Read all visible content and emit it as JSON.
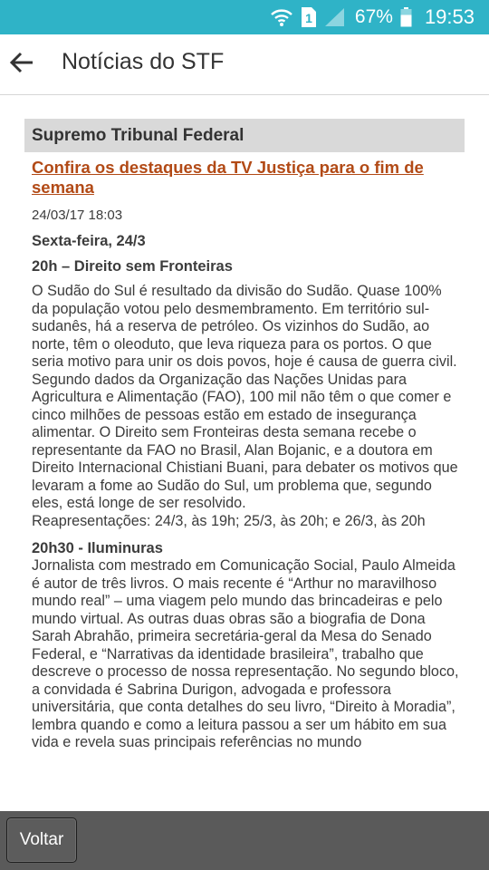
{
  "status_bar": {
    "sim_label": "1",
    "battery_percent": "67%",
    "time": "19:53",
    "icons": [
      "wifi-icon",
      "sim-icon",
      "signal-icon",
      "battery-icon"
    ]
  },
  "app_bar": {
    "title": "Notícias do STF",
    "back_icon": "arrow-left-icon"
  },
  "section": {
    "header": "Supremo Tribunal Federal"
  },
  "article": {
    "title": "Confira os destaques da TV Justiça para o fim de semana",
    "date": "24/03/17 18:03",
    "day_heading": "Sexta-feira, 24/3",
    "program1": {
      "heading": "20h – Direito sem Fronteiras",
      "body": "O Sudão do Sul é resultado da divisão do Sudão. Quase 100% da população votou pelo desmembramento. Em território sul-sudanês, há a reserva de petróleo. Os vizinhos do Sudão, ao norte, têm o oleoduto, que leva riqueza para os portos. O que seria motivo para unir os dois povos, hoje é causa de guerra civil. Segundo dados da Organização das Nações Unidas para Agricultura e Alimentação (FAO), 100 mil não têm o que comer e cinco milhões de pessoas estão em estado de insegurança alimentar. O Direito sem Fronteiras desta semana recebe o representante da FAO no Brasil, Alan Bojanic, e a doutora em Direito Internacional Chistiani Buani, para debater os motivos que levaram a fome ao Sudão do Sul, um problema que, segundo eles, está longe de ser resolvido.",
      "reruns": "Reapresentações: 24/3, às 19h; 25/3, às 20h; e 26/3, às 20h"
    },
    "program2": {
      "heading": "20h30 - Iluminuras",
      "body": "Jornalista com mestrado em Comunicação Social, Paulo Almeida é autor de três livros. O mais recente é “Arthur no maravilhoso mundo real” – uma viagem pelo mundo das brincadeiras e pelo mundo virtual. As outras duas obras são a biografia de Dona Sarah Abrahão, primeira secretária-geral da Mesa do Senado Federal, e “Narrativas da identidade brasileira”, trabalho que descreve o processo de nossa representação. No segundo bloco, a convidada é Sabrina Durigon, advogada e professora universitária, que conta detalhes do seu livro, “Direito à Moradia”, lembra quando e como a leitura passou a ser um hábito em sua vida e revela suas principais referências no mundo"
    }
  },
  "bottom_bar": {
    "back_button_label": "Voltar"
  },
  "colors": {
    "status_bar": "#2fb3c7",
    "link": "#b24a16",
    "section_header_bg": "#d9d9d9",
    "bottom_bar": "#5a5a5a"
  }
}
